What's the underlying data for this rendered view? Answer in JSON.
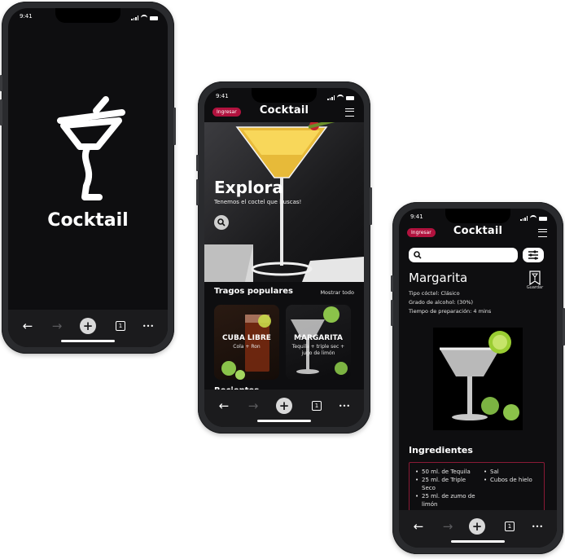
{
  "status": {
    "time": "9:41"
  },
  "splash": {
    "brand": "Cocktail"
  },
  "explore": {
    "ingresar": "Ingresar",
    "brand": "Cocktail",
    "hero_title": "Explora",
    "hero_subtitle": "Tenemos el coctel que buscas!",
    "section_title": "Tragos populares",
    "show_all": "Mostrar todo",
    "cards": [
      {
        "title": "CUBA LIBRE",
        "sub": "Cola + Ron"
      },
      {
        "title": "MARGARITA",
        "sub": "Tequila + triple sec + jugo de limón"
      }
    ],
    "recent_title": "Recientes"
  },
  "detail": {
    "ingresar": "Ingresar",
    "brand": "Cocktail",
    "drink_name": "Margarita",
    "save_label": "Guardar",
    "tipo": "Tipo cóctel: Clásico",
    "grado": "Grado de alcohol: (30%)",
    "tiempo": "Tiempo de preparación:  4 mins",
    "ingredients_title": "Ingredientes",
    "ingredients_left": [
      "50 ml. de Tequila",
      "25 ml. de Triple Seco",
      "25 ml. de zumo de limón"
    ],
    "ingredients_right": [
      "Sal",
      "Cubos de hielo"
    ]
  },
  "nav": {
    "back": "←",
    "forward": "→",
    "plus": "+",
    "tabs": "1",
    "more": "•••"
  },
  "colors": {
    "accent": "#b1123e",
    "screen": "#0e0e10",
    "nav": "#1b1b1d"
  }
}
